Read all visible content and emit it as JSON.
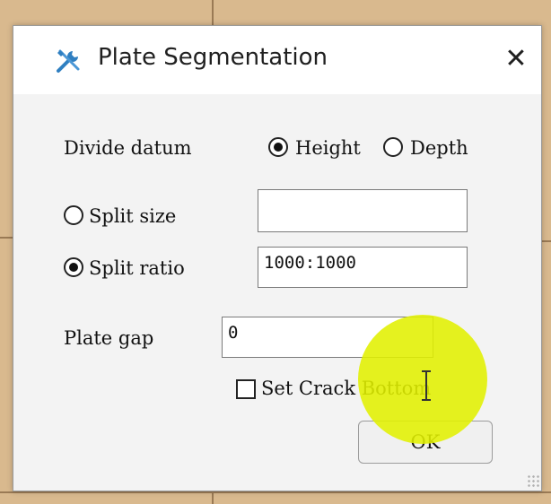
{
  "dialog": {
    "title": "Plate Segmentation",
    "close_symbol": "✕",
    "icon": "tools-icon"
  },
  "divide_datum": {
    "label": "Divide datum",
    "options": [
      {
        "label": "Height",
        "selected": true
      },
      {
        "label": "Depth",
        "selected": false
      }
    ]
  },
  "split_size": {
    "label": "Split size",
    "selected": false,
    "value": ""
  },
  "split_ratio": {
    "label": "Split ratio",
    "selected": true,
    "value": "1000:1000"
  },
  "plate_gap": {
    "label": "Plate gap",
    "value": "0"
  },
  "set_crack_bottom": {
    "label": "Set Crack Bottom",
    "checked": false
  },
  "ok_button": {
    "label": "OK"
  },
  "colors": {
    "cursor_highlight": "#e1f000",
    "icon_blue": "#2f7fc1"
  }
}
